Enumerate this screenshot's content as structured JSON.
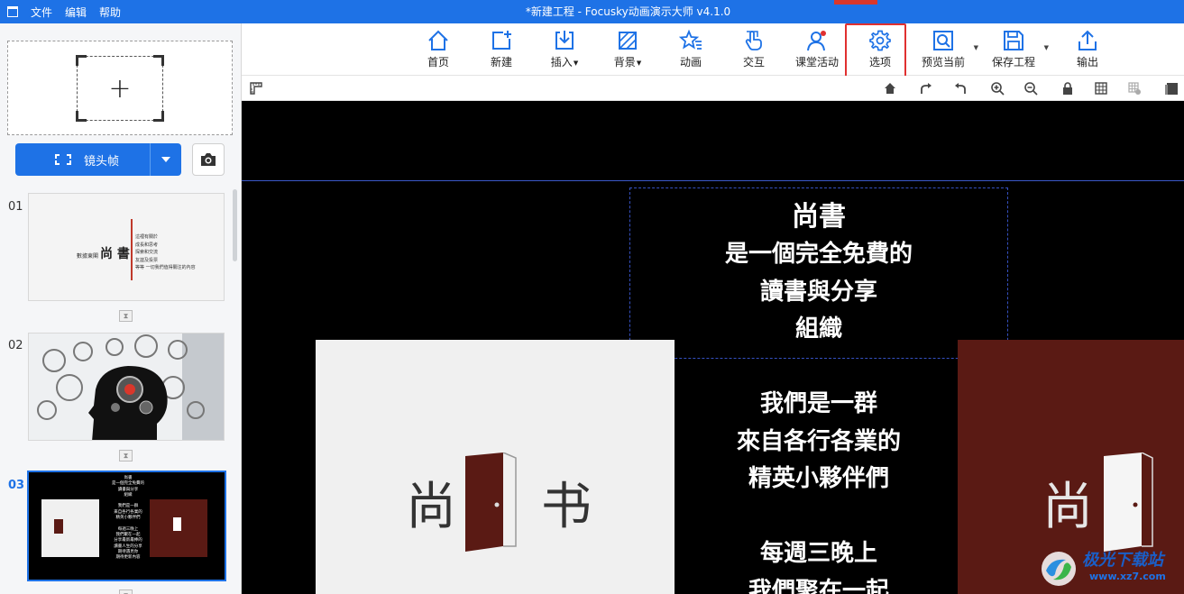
{
  "titlebar": {
    "menu": [
      "文件",
      "编辑",
      "帮助"
    ],
    "title": "*新建工程 - Focusky动画演示大师  v4.1.0"
  },
  "left_panel": {
    "add_plus": "+",
    "camera_frame_label": "镜头帧",
    "slides": [
      {
        "num": "01",
        "active": false
      },
      {
        "num": "02",
        "active": false
      },
      {
        "num": "03",
        "active": true
      }
    ],
    "thumb1": {
      "prefix": "數據東閣",
      "title": "尚 書",
      "lines": [
        "這裡有關於",
        "成長和思考",
        "探索和交流",
        "友誼及投票",
        "等等 一切我們值得關注的內容"
      ]
    },
    "thumb3": {
      "lines": [
        "尚書",
        "是一個完全免費的",
        "讀書與分享",
        "組織",
        "",
        "我們是一群",
        "來自各行各業的",
        "精英小夥伴們",
        "",
        "每週三晚上",
        "我們聚在一起",
        "分享最新最棒的",
        "讀書人生的分享",
        "期待遇見你",
        "期待更新內容"
      ]
    }
  },
  "toolbar": {
    "buttons": [
      {
        "label": "首页"
      },
      {
        "label": "新建"
      },
      {
        "label": "插入",
        "submenu": true
      },
      {
        "label": "背景",
        "submenu": true
      },
      {
        "label": "动画"
      },
      {
        "label": "交互"
      },
      {
        "label": "课堂活动"
      },
      {
        "label": "选项"
      },
      {
        "label": "预览当前"
      },
      {
        "label": "保存工程"
      },
      {
        "label": "输出"
      }
    ]
  },
  "canvas": {
    "text_lines": [
      "尚書",
      "是一個完全免費的",
      "讀書與分享",
      "組織",
      "",
      "我們是一群",
      "來自各行各業的",
      "精英小夥伴們",
      "",
      "每週三晚上",
      "我們聚在一起"
    ],
    "card_left": {
      "chars": [
        "尚",
        "书"
      ]
    },
    "card_right": {
      "chars": [
        "尚"
      ]
    }
  },
  "watermark": {
    "line1": "极光下载站",
    "line2": "www.xz7.com"
  },
  "colors": {
    "accent": "#1e72e6",
    "highlight": "#e03030",
    "canvas_bg": "#000000",
    "door": "#5a1a14"
  }
}
